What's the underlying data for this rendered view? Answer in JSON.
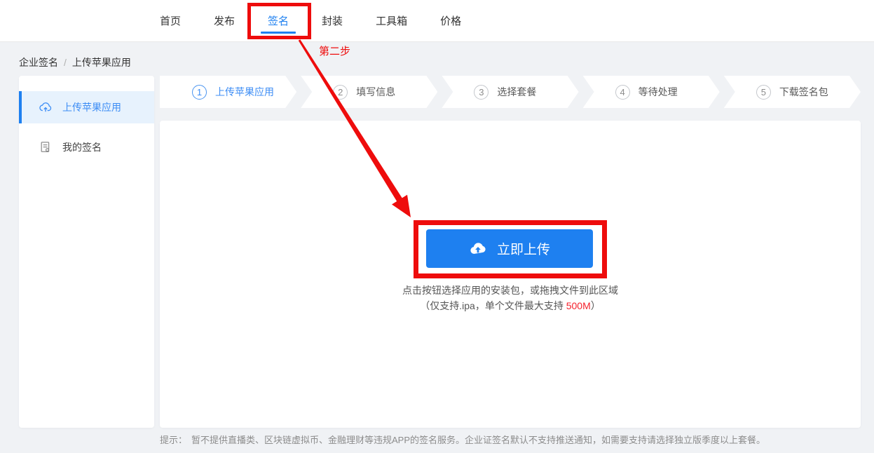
{
  "nav": {
    "items": [
      "首页",
      "发布",
      "签名",
      "封装",
      "工具箱",
      "价格"
    ],
    "active_index": 2
  },
  "annotation": {
    "step_note": "第二步"
  },
  "breadcrumb": {
    "root": "企业签名",
    "separator": "/",
    "current": "上传苹果应用"
  },
  "sidebar": {
    "items": [
      {
        "label": "上传苹果应用",
        "icon": "cloud-upload-icon",
        "active": true
      },
      {
        "label": "我的签名",
        "icon": "signature-doc-icon",
        "active": false
      }
    ]
  },
  "steps": {
    "items": [
      {
        "num": "1",
        "label": "上传苹果应用",
        "active": true
      },
      {
        "num": "2",
        "label": "填写信息",
        "active": false
      },
      {
        "num": "3",
        "label": "选择套餐",
        "active": false
      },
      {
        "num": "4",
        "label": "等待处理",
        "active": false
      },
      {
        "num": "5",
        "label": "下载签名包",
        "active": false
      }
    ]
  },
  "upload": {
    "button_label": "立即上传",
    "hint_line1": "点击按钮选择应用的安装包，或拖拽文件到此区域",
    "hint_line2_prefix": "（仅支持.ipa，单个文件最大支持 ",
    "hint_size_limit": "500M",
    "hint_line2_suffix": "）"
  },
  "footer": {
    "tip_label": "提示：",
    "tip_text": "暂不提供直播类、区块链虚拟币、金融理财等违规APP的签名服务。企业证签名默认不支持推送通知，如需要支持请选择独立版季度以上套餐。"
  },
  "colors": {
    "primary_blue": "#1e80f0",
    "annotation_red": "#ee0c0c",
    "size_limit_red": "#f5222d",
    "sidebar_active_bg": "#e7f2fd",
    "page_bg": "#f0f2f5"
  }
}
